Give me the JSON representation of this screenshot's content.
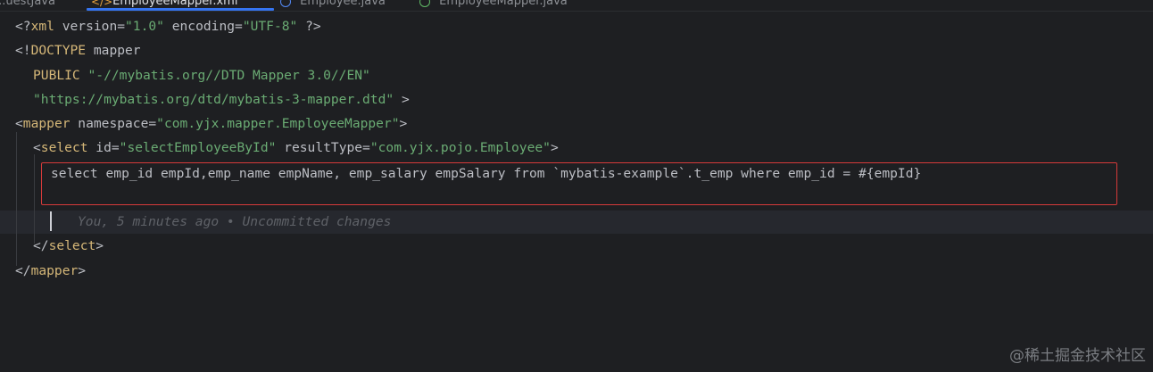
{
  "tabs": [
    {
      "label": "...uestJava",
      "active": false
    },
    {
      "label": "EmployeeMapper.xml",
      "active": true
    },
    {
      "label": "Employee.java",
      "active": false
    },
    {
      "label": "EmployeeMapper.java",
      "active": false
    }
  ],
  "code": {
    "line1": {
      "open": "<?",
      "tag": "xml",
      "a1": " version=",
      "v1": "\"1.0\"",
      "a2": " encoding=",
      "v2": "\"UTF-8\"",
      "close": " ?>"
    },
    "line2": {
      "open": "<!",
      "kw": "DOCTYPE",
      "rest": " mapper"
    },
    "line3": {
      "kw": "PUBLIC",
      "str": "\"-//mybatis.org//DTD Mapper 3.0//EN\""
    },
    "line4": {
      "str": "\"https://mybatis.org/dtd/mybatis-3-mapper.dtd\"",
      "close": " >"
    },
    "line5": {
      "open": "<",
      "tag": "mapper",
      "attr": " namespace=",
      "val": "\"com.yjx.mapper.EmployeeMapper\"",
      "close": ">"
    },
    "line6": {
      "open": "<",
      "tag": "select",
      "a1": " id=",
      "v1": "\"selectEmployeeById\"",
      "a2": " resultType=",
      "v2": "\"com.yjx.pojo.Employee\"",
      "close": ">"
    },
    "sql": "select emp_id empId,emp_name empName, emp_salary empSalary from `mybatis-example`.t_emp where emp_id = #{empId}",
    "blame": "You, 5 minutes ago • Uncommitted changes",
    "line9": {
      "open": "</",
      "tag": "select",
      "close": ">"
    },
    "line10": {
      "open": "</",
      "tag": "mapper",
      "close": ">"
    }
  },
  "watermark": "@稀土掘金技术社区",
  "colors": {
    "background": "#1e1f22",
    "tag": "#d5b778",
    "string": "#6aab73",
    "keyword": "#cf8e6d",
    "highlight_box": "#d63a3a"
  }
}
